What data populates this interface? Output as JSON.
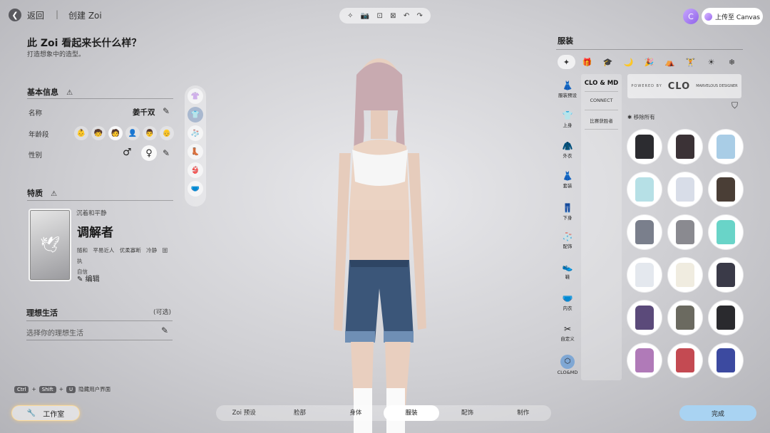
{
  "topbar": {
    "back_label": "返回",
    "separator": "|",
    "breadcrumb": "创建 Zoi",
    "toolbar_icons": [
      "✧",
      "📷",
      "⊡",
      "⊠",
      "↶",
      "↷"
    ],
    "canvas_user_initial": "C",
    "upload_label": "上传至 Canvas"
  },
  "left": {
    "title": "此 Zoi 看起来长什么样？",
    "subtitle": "打造想象中的造型。",
    "basic_info": {
      "title": "基本信息",
      "name_label": "名称",
      "name_value": "姜千双",
      "age_label": "年龄段",
      "age_icons": [
        "👶",
        "🧒",
        "🧑",
        "👤",
        "👨",
        "👴"
      ],
      "gender_label": "性别",
      "gender_male": "♂",
      "gender_female": "♀"
    },
    "trait": {
      "title": "特质",
      "card_icon": "🕊",
      "subtitle": "沉着和平静",
      "name": "调解者",
      "tags": [
        "随和",
        "平易近人",
        "优柔寡断",
        "冷静",
        "固执",
        "自信"
      ],
      "edit_label": "编辑"
    },
    "life": {
      "title": "理想生活",
      "optional": "(可选)",
      "placeholder": "选择你的理想生活"
    },
    "thumb_icons": [
      "👚",
      "👕",
      "🧦",
      "👢",
      "👙",
      "🩲"
    ]
  },
  "shortcut": {
    "key_ctrl": "Ctrl",
    "key_shift": "Shift",
    "key_u": "U",
    "plus": "+",
    "label": "隐藏用户界面"
  },
  "studio": {
    "icon": "🔧",
    "label": "工作室"
  },
  "bottom_tabs": [
    {
      "label": "Zoi 预设"
    },
    {
      "label": "脸部"
    },
    {
      "label": "身体"
    },
    {
      "label": "服装"
    },
    {
      "label": "配饰"
    },
    {
      "label": "制作"
    }
  ],
  "active_tab": "服装",
  "done_label": "完成",
  "right": {
    "title": "服装",
    "categories": [
      "✦",
      "🎁",
      "🎓",
      "🌙",
      "🎉",
      "⛺",
      "🏋",
      "☀",
      "❄"
    ],
    "nav": [
      {
        "icon": "👗",
        "label": "服装预设"
      },
      {
        "icon": "👕",
        "label": "上身"
      },
      {
        "icon": "🧥",
        "label": "外衣"
      },
      {
        "icon": "👗",
        "label": "套装"
      },
      {
        "icon": "👖",
        "label": "下身"
      },
      {
        "icon": "🧦",
        "label": "配饰"
      },
      {
        "icon": "👟",
        "label": "鞋"
      },
      {
        "icon": "🩲",
        "label": "内衣"
      },
      {
        "icon": "✂",
        "label": "自定义"
      },
      {
        "icon": "⬡",
        "label": "CLO&MD"
      }
    ],
    "brand": {
      "clo_md": "CLO & MD",
      "connect": "CONNECT",
      "winners": "比赛获胜者",
      "powered_by": "POWERED BY",
      "clo_logo": "CLO",
      "marvelous": "MARVELOUS DESIGNER"
    },
    "filter_icon": "⛉",
    "remove_all": "✱ 移除所有"
  },
  "colors": {
    "accent_done": "#a9d3f2",
    "items": [
      "#2c2c30",
      "#3b3236",
      "#a9cde6",
      "#b6e0e6",
      "#d8dde8",
      "#4a3e36",
      "#7a7f8c",
      "#8a8a90",
      "#69d4c8",
      "#e4e8ee",
      "#f0ece0",
      "#3a3a48",
      "#5b4a7a",
      "#6b6a60",
      "#2a2a2e",
      "#b07ab8",
      "#c44a52",
      "#3c4aa0"
    ]
  }
}
